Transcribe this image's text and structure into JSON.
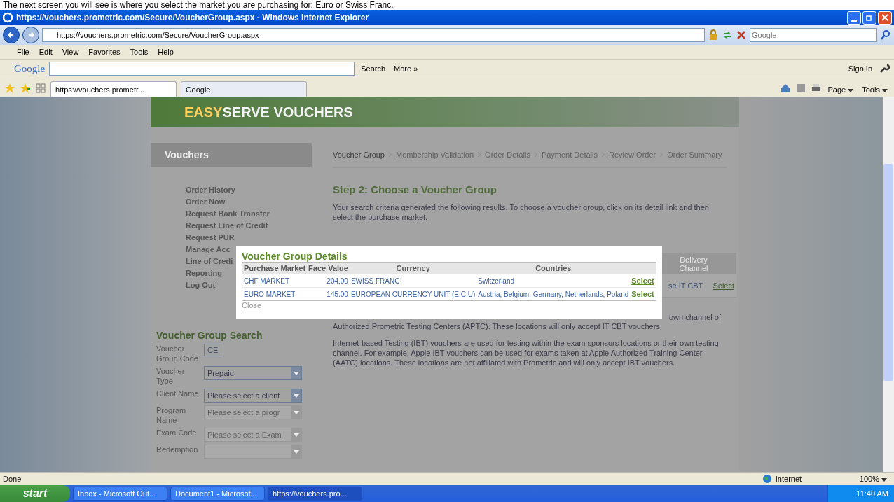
{
  "caption": "The next screen you will see is where you select the market you are purchasing for: Euro or Swiss Franc.",
  "window": {
    "title": "https://vouchers.prometric.com/Secure/VoucherGroup.aspx - Windows Internet Explorer"
  },
  "address_bar": {
    "url": "https://vouchers.prometric.com/Secure/VoucherGroup.aspx",
    "search_placeholder": "Google"
  },
  "menu": [
    "File",
    "Edit",
    "View",
    "Favorites",
    "Tools",
    "Help"
  ],
  "google_toolbar": {
    "logo": "Google",
    "search_label": "Search",
    "more": "More »",
    "sign_in": "Sign In"
  },
  "tabs": [
    {
      "label": "https://vouchers.prometr...",
      "selected": true
    },
    {
      "label": "Google",
      "selected": false
    }
  ],
  "command_bar": {
    "page": "Page",
    "tools": "Tools"
  },
  "site": {
    "logo_accent": "EASY",
    "logo_rest": "SERVE VOUCHERS"
  },
  "sidebar": {
    "title": "Vouchers",
    "items": [
      "Order History",
      "Order Now",
      "Request Bank Transfer",
      "Request Line of Credit",
      "Request PUR",
      "Manage Acc",
      "Line of Credi",
      "Reporting",
      "Log Out"
    ]
  },
  "search_form": {
    "title": "Voucher Group Search",
    "fields": [
      {
        "label": "Voucher Group Code",
        "kind": "text",
        "value": "CE",
        "disabled": false
      },
      {
        "label": "Voucher Type",
        "kind": "select",
        "value": "Prepaid",
        "disabled": false
      },
      {
        "label": "Client Name",
        "kind": "select",
        "value": "Please select a client",
        "disabled": false
      },
      {
        "label": "Program Name",
        "kind": "select",
        "value": "Please select a progr",
        "disabled": true
      },
      {
        "label": "Exam Code",
        "kind": "select",
        "value": "Please select a Exam",
        "disabled": true
      },
      {
        "label": "Redemption",
        "kind": "select",
        "disabled": true
      }
    ]
  },
  "breadcrumb": [
    {
      "label": "Voucher Group",
      "selected": true
    },
    {
      "label": "Membership Validation",
      "selected": false
    },
    {
      "label": "Order Details",
      "selected": false
    },
    {
      "label": "Payment Details",
      "selected": false
    },
    {
      "label": "Review Order",
      "selected": false
    },
    {
      "label": "Order Summary",
      "selected": false
    }
  ],
  "step_title": "Step 2: Choose a Voucher Group",
  "intro": "Your search criteria generated the following results. To choose a voucher group, click on its detail link and then select the purchase market.",
  "results_table": {
    "header": "Delivery Channel",
    "cell": "se IT CBT",
    "link": "Select"
  },
  "para1_tail": "own channel of",
  "para1": "Authorized Prometric Testing Centers (APTC). These locations will only accept IT CBT vouchers.",
  "para2": "Internet-based Testing (IBT) vouchers are used for testing within the exam sponsors locations or their own testing channel. For example, Apple IBT vouchers can be used for exams taken at Apple Authorized Training Center (AATC) locations. These locations are not affiliated with Prometric and will only accept IBT vouchers.",
  "dialog": {
    "title": "Voucher Group Details",
    "columns": [
      "Purchase Market",
      "Face Value",
      "Currency",
      "Countries"
    ],
    "rows": [
      {
        "market": "CHF MARKET",
        "value": "204.00",
        "currency": "SWISS FRANC",
        "countries": "Switzerland",
        "action": "Select"
      },
      {
        "market": "EURO MARKET",
        "value": "145.00",
        "currency": "EUROPEAN CURRENCY UNIT (E.C.U)",
        "countries": "Austria, Belgium, Germany, Netherlands, Poland",
        "action": "Select"
      }
    ],
    "close": "Close"
  },
  "status_bar": {
    "text": "Done",
    "zone": "Internet",
    "zoom": "100%"
  },
  "taskbar": {
    "start": "start",
    "items": [
      {
        "label": "Inbox - Microsoft Out...",
        "selected": false
      },
      {
        "label": "Document1 - Microsof...",
        "selected": false
      },
      {
        "label": "https://vouchers.pro...",
        "selected": true
      }
    ],
    "time": "11:40 AM"
  }
}
